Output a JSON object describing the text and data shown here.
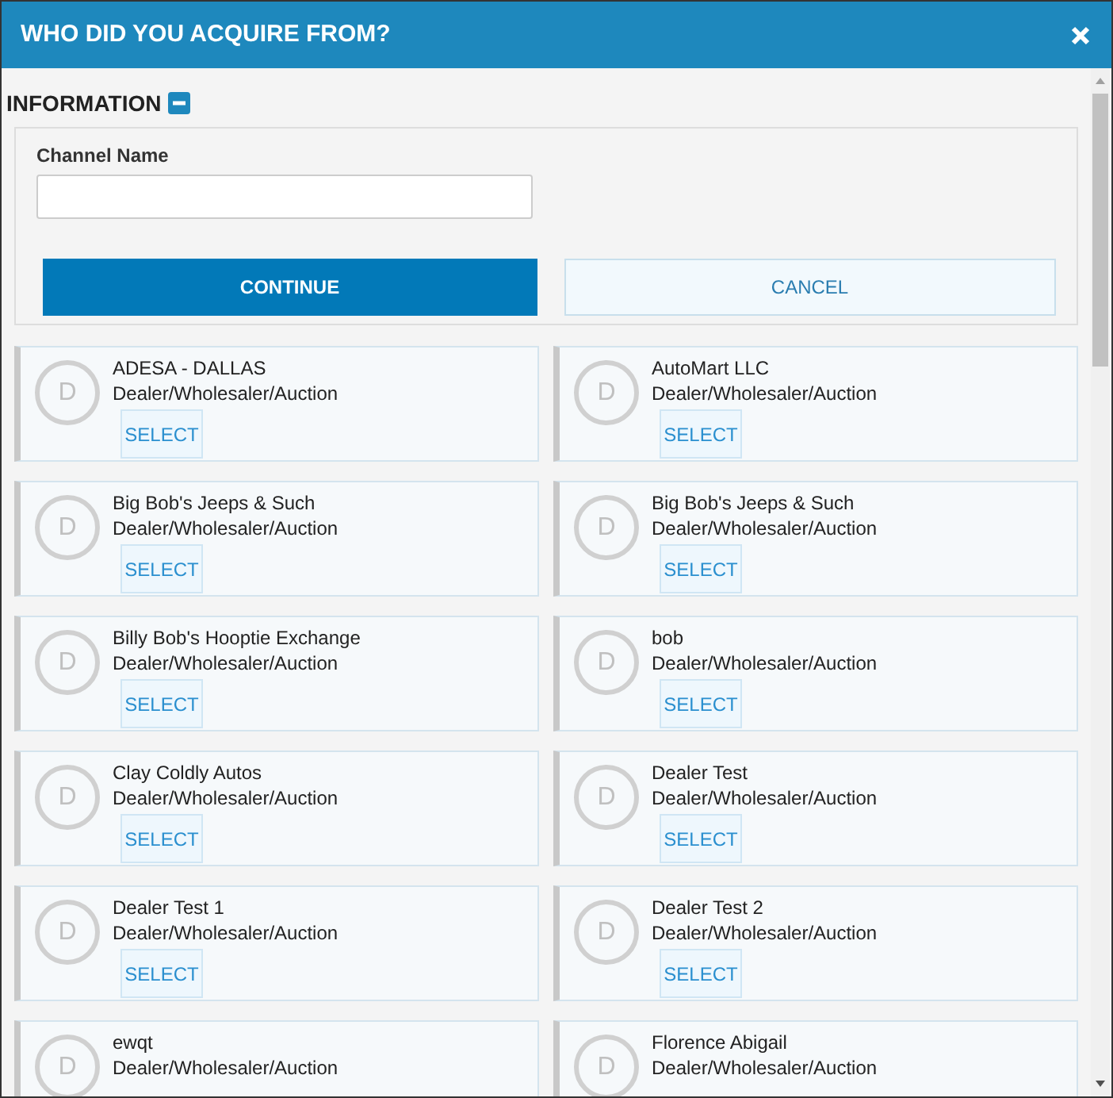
{
  "dialog": {
    "title": "WHO DID YOU ACQUIRE FROM?"
  },
  "section": {
    "title": "INFORMATION",
    "expanded": true
  },
  "form": {
    "label": "Channel Name",
    "buttons": [
      {
        "label": "CONTINUE",
        "kind": "primary"
      },
      {
        "label": "CANCEL",
        "kind": "secondary"
      }
    ]
  },
  "channels": [
    {
      "avatar": "D",
      "name": "ADESA - DALLAS",
      "type": "Dealer/Wholesaler/Auction",
      "action": "SELECT"
    },
    {
      "avatar": "D",
      "name": "AutoMart LLC",
      "type": "Dealer/Wholesaler/Auction",
      "action": "SELECT"
    },
    {
      "avatar": "D",
      "name": "Big Bob's Jeeps & Such",
      "type": "Dealer/Wholesaler/Auction",
      "action": "SELECT"
    },
    {
      "avatar": "D",
      "name": "Big Bob's Jeeps & Such",
      "type": "Dealer/Wholesaler/Auction",
      "action": "SELECT"
    },
    {
      "avatar": "D",
      "name": "Billy Bob's Hooptie Exchange",
      "type": "Dealer/Wholesaler/Auction",
      "action": "SELECT"
    },
    {
      "avatar": "D",
      "name": "bob",
      "type": "Dealer/Wholesaler/Auction",
      "action": "SELECT"
    },
    {
      "avatar": "D",
      "name": "Clay Coldly Autos",
      "type": "Dealer/Wholesaler/Auction",
      "action": "SELECT"
    },
    {
      "avatar": "D",
      "name": "Dealer Test",
      "type": "Dealer/Wholesaler/Auction",
      "action": "SELECT"
    },
    {
      "avatar": "D",
      "name": "Dealer Test 1",
      "type": "Dealer/Wholesaler/Auction",
      "action": "SELECT"
    },
    {
      "avatar": "D",
      "name": "Dealer Test 2",
      "type": "Dealer/Wholesaler/Auction",
      "action": "SELECT"
    },
    {
      "avatar": "D",
      "name": "ewqt",
      "type": "Dealer/Wholesaler/Auction"
    },
    {
      "avatar": "D",
      "name": "Florence Abigail",
      "type": "Dealer/Wholesaler/Auction"
    }
  ]
}
